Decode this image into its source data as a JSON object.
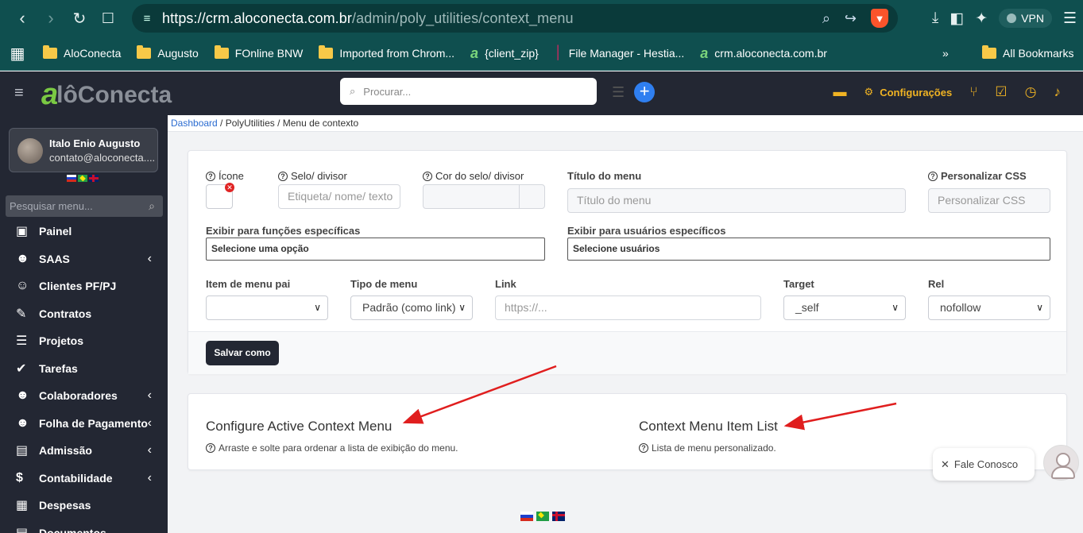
{
  "browser": {
    "url_host": "https://crm.aloconecta.com.br",
    "url_path": "/admin/poly_utilities/context_menu",
    "vpn_label": "VPN",
    "bookmarks": [
      {
        "label": "AloConecta",
        "icon": "folder-icon"
      },
      {
        "label": "Augusto",
        "icon": "folder-icon"
      },
      {
        "label": "FOnline BNW",
        "icon": "folder-icon"
      },
      {
        "label": "Imported from Chrom...",
        "icon": "folder-icon"
      },
      {
        "label": "{client_zip}",
        "icon": "aloconecta-favicon"
      },
      {
        "label": "File Manager - Hestia...",
        "icon": "hestia-favicon"
      },
      {
        "label": "crm.aloconecta.com.br",
        "icon": "aloconecta-favicon"
      }
    ],
    "all_bookmarks": "All Bookmarks"
  },
  "header": {
    "logo_a": "a",
    "logo_text": "lôConecta",
    "search_placeholder": "Procurar...",
    "config_label": "Configurações"
  },
  "sidebar": {
    "user_name": "Italo Enio Augusto",
    "user_email": "contato@aloconecta....",
    "menu_search_placeholder": "Pesquisar menu...",
    "items": [
      {
        "label": "Painel",
        "icon": "▣",
        "chevron": false
      },
      {
        "label": "SAAS",
        "icon": "☻",
        "chevron": true
      },
      {
        "label": "Clientes PF/PJ",
        "icon": "☺",
        "chevron": false
      },
      {
        "label": "Contratos",
        "icon": "✎",
        "chevron": false
      },
      {
        "label": "Projetos",
        "icon": "☰",
        "chevron": false
      },
      {
        "label": "Tarefas",
        "icon": "✔",
        "chevron": false
      },
      {
        "label": "Colaboradores",
        "icon": "☻",
        "chevron": true
      },
      {
        "label": "Folha de Pagamento",
        "icon": "☻",
        "chevron": true
      },
      {
        "label": "Admissão",
        "icon": "▤",
        "chevron": true
      },
      {
        "label": "Contabilidade",
        "icon": "$",
        "chevron": true
      },
      {
        "label": "Despesas",
        "icon": "▦",
        "chevron": false
      },
      {
        "label": "Documentos",
        "icon": "▤",
        "chevron": false
      }
    ]
  },
  "breadcrumb": {
    "link": "Dashboard",
    "rest": " / PolyUtilities / Menu de contexto"
  },
  "form": {
    "icon_label": "Ícone",
    "seal_label": "Selo/ divisor",
    "seal_placeholder": "Etiqueta/ nome/ texto",
    "seal_color_label": "Cor do selo/ divisor",
    "menu_title_label": "Título do menu",
    "menu_title_placeholder": "Título do menu",
    "custom_css_label": "Personalizar CSS",
    "custom_css_placeholder": "Personalizar CSS",
    "roles_label": "Exibir para funções específicas",
    "roles_placeholder": "Selecione uma opção",
    "users_label": "Exibir para usuários específicos",
    "users_placeholder": "Selecione usuários",
    "parent_label": "Item de menu pai",
    "parent_value": "",
    "type_label": "Tipo de menu",
    "type_value": "Padrão (como link)",
    "link_label": "Link",
    "link_placeholder": "https://...",
    "target_label": "Target",
    "target_value": "_self",
    "rel_label": "Rel",
    "rel_value": "nofollow",
    "save_label": "Salvar como"
  },
  "panels": {
    "active_title": "Configure Active Context Menu",
    "active_help": "Arraste e solte para ordenar a lista de exibição do menu.",
    "list_title": "Context Menu Item List",
    "list_help": "Lista de menu personalizado."
  },
  "chat": {
    "label": "Fale Conosco"
  },
  "colors": {
    "browser_bg": "#0f4f4f",
    "app_dark": "#232733",
    "accent_yellow": "#f0b323",
    "primary_blue": "#2f7ff0",
    "arrow_red": "#e01e1e"
  }
}
